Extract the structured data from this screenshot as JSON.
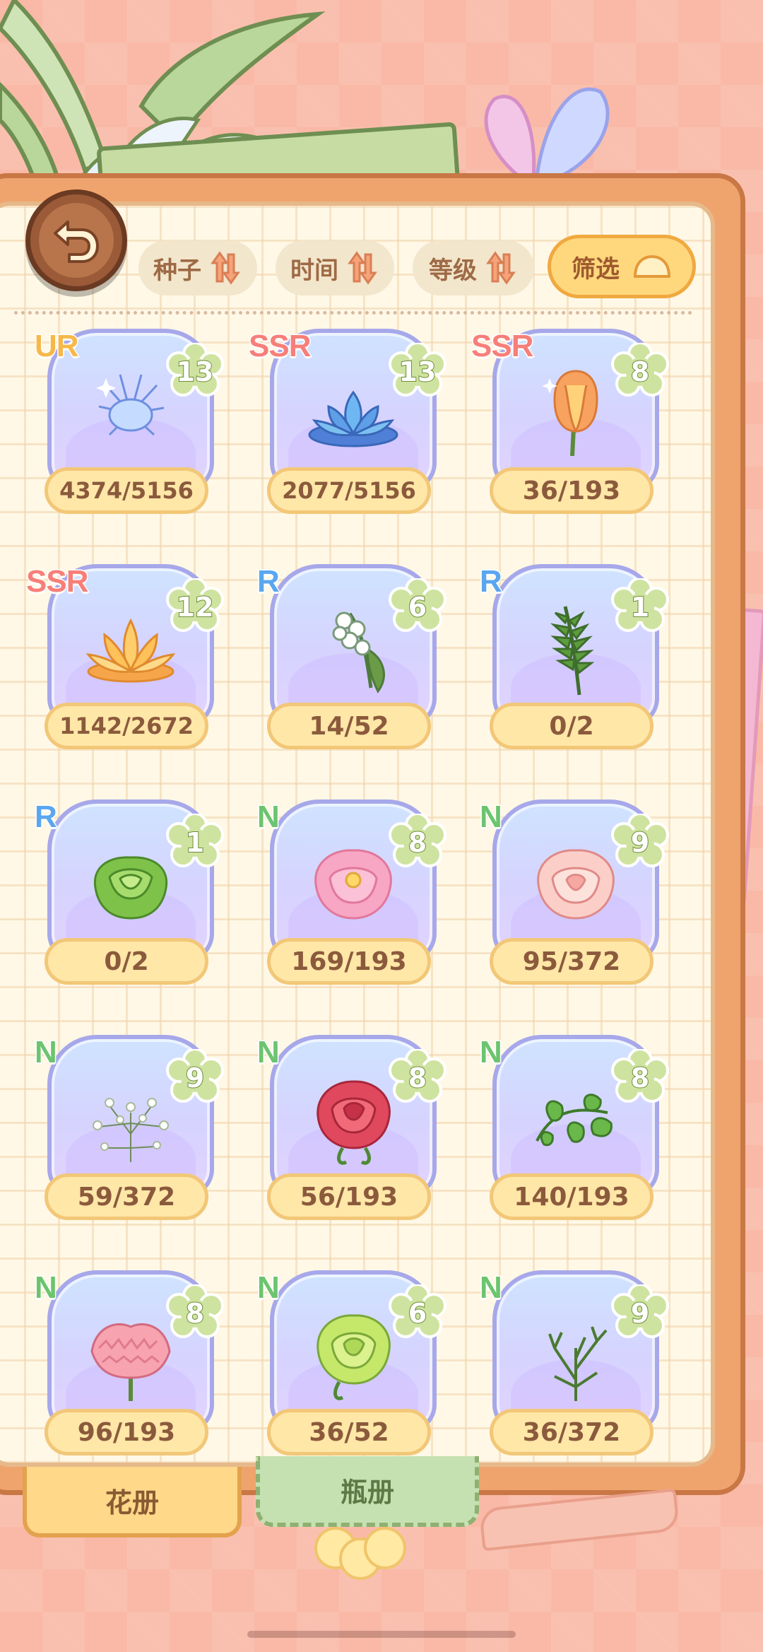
{
  "sort_bar": {
    "seed_label": "种子",
    "time_label": "时间",
    "level_label": "等级",
    "filter_label": "筛选"
  },
  "rarity_colors": {
    "UR": "#f7b84a",
    "SSR": "#f77f79",
    "R": "#5aa6f0",
    "N": "#6cc46f"
  },
  "cards": [
    {
      "rarity": "UR",
      "level": "13",
      "count": "4374/5156",
      "flower": "blue-spirit-flower"
    },
    {
      "rarity": "SSR",
      "level": "13",
      "count": "2077/5156",
      "flower": "blue-lotus"
    },
    {
      "rarity": "SSR",
      "level": "8",
      "count": "36/193",
      "flower": "orange-tulip"
    },
    {
      "rarity": "SSR",
      "level": "12",
      "count": "1142/2672",
      "flower": "golden-lotus"
    },
    {
      "rarity": "R",
      "level": "6",
      "count": "14/52",
      "flower": "lily-of-the-valley"
    },
    {
      "rarity": "R",
      "level": "1",
      "count": "0/2",
      "flower": "fern"
    },
    {
      "rarity": "R",
      "level": "1",
      "count": "0/2",
      "flower": "green-cabbage-rose"
    },
    {
      "rarity": "N",
      "level": "8",
      "count": "169/193",
      "flower": "pink-peony"
    },
    {
      "rarity": "N",
      "level": "9",
      "count": "95/372",
      "flower": "peach-peony"
    },
    {
      "rarity": "N",
      "level": "9",
      "count": "59/372",
      "flower": "babys-breath"
    },
    {
      "rarity": "N",
      "level": "8",
      "count": "56/193",
      "flower": "red-rose"
    },
    {
      "rarity": "N",
      "level": "8",
      "count": "140/193",
      "flower": "green-vine"
    },
    {
      "rarity": "N",
      "level": "8",
      "count": "96/193",
      "flower": "pink-carnation"
    },
    {
      "rarity": "N",
      "level": "6",
      "count": "36/52",
      "flower": "green-rose"
    },
    {
      "rarity": "N",
      "level": "9",
      "count": "36/372",
      "flower": "green-branch"
    }
  ],
  "tabs": {
    "flower_book": "花册",
    "bottle_book": "瓶册"
  }
}
